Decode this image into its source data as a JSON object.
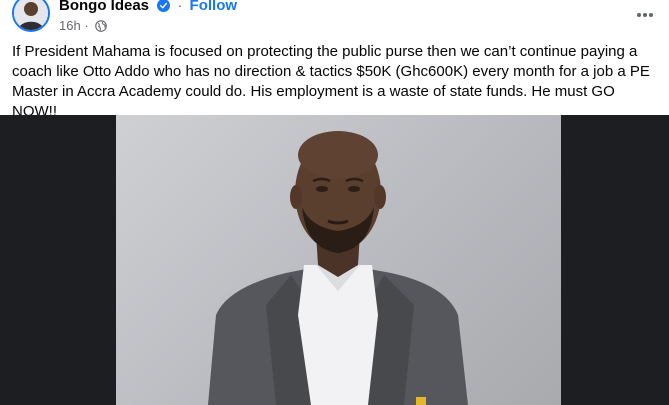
{
  "post": {
    "author": "Bongo Ideas",
    "follow_label": "Follow",
    "separator": "·",
    "timestamp": "16h",
    "meta_separator": "·",
    "text": "If President Mahama is focused on protecting the public purse then we can’t continue paying a coach like Otto Addo who has no direction & tactics $50K (Ghc600K) every month for a job a PE Master in Accra Academy could do. His employment is a waste of state funds. He must GO NOW!!"
  },
  "icons": {
    "verified": "verified-badge-icon",
    "audience": "globe-icon",
    "more": "more-options-icon"
  },
  "colors": {
    "accent": "#1877f2",
    "text": "#050505",
    "secondary": "#65676b",
    "media_background": "#1c1e21"
  }
}
